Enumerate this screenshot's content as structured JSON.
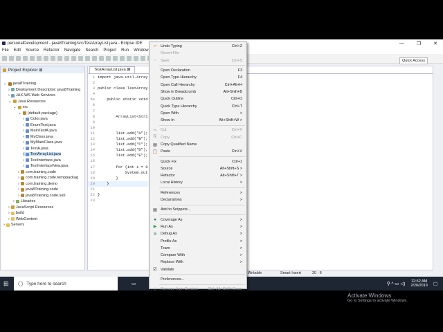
{
  "window": {
    "title": "personalDevelopment - java8Training/src/TestArrayList.java - Eclipse IDE",
    "controls": [
      "—",
      "❐",
      "✕"
    ]
  },
  "menubar": [
    "File",
    "Edit",
    "Source",
    "Refactor",
    "Navigate",
    "Search",
    "Project",
    "Run",
    "Window",
    "Help"
  ],
  "quick_access": "Quick Access",
  "project_explorer": {
    "title": "Project Explorer ⊠",
    "items": [
      {
        "label": "java8Training",
        "depth": 0,
        "arrow": "v",
        "color": "#a7742a"
      },
      {
        "label": "Deployment Descriptor: java8Training",
        "depth": 1,
        "arrow": ">",
        "color": "#7a9"
      },
      {
        "label": "JAX-WS Web Services",
        "depth": 1,
        "arrow": ">",
        "color": "#79b"
      },
      {
        "label": "Java Resources",
        "depth": 1,
        "arrow": "v",
        "color": "#c9a040"
      },
      {
        "label": "src",
        "depth": 2,
        "arrow": "v",
        "color": "#c9a040"
      },
      {
        "label": "(default package)",
        "depth": 3,
        "arrow": "v",
        "color": "#b8863b"
      },
      {
        "label": "Color.java",
        "depth": 4,
        "arrow": ">",
        "color": "#6a8fc7"
      },
      {
        "label": "EnumTest.java",
        "depth": 4,
        "arrow": ">",
        "color": "#6a8fc7"
      },
      {
        "label": "MainTestA.java",
        "depth": 4,
        "arrow": ">",
        "color": "#6a8fc7"
      },
      {
        "label": "MyClass.java",
        "depth": 4,
        "arrow": ">",
        "color": "#6a8fc7"
      },
      {
        "label": "MyMainClass.java",
        "depth": 4,
        "arrow": ">",
        "color": "#6a8fc7"
      },
      {
        "label": "TestA.java",
        "depth": 4,
        "arrow": ">",
        "color": "#6a8fc7"
      },
      {
        "label": "TestArrayList.java",
        "depth": 4,
        "arrow": ">",
        "color": "#6a8fc7",
        "selected": true
      },
      {
        "label": "TestInterface.java",
        "depth": 4,
        "arrow": ">",
        "color": "#6a8fc7"
      },
      {
        "label": "TestInterfaceNew.java",
        "depth": 4,
        "arrow": ">",
        "color": "#6a8fc7"
      },
      {
        "label": "com.training.code",
        "depth": 3,
        "arrow": ">",
        "color": "#b8863b"
      },
      {
        "label": "com.training.code.temppackag",
        "depth": 3,
        "arrow": ">",
        "color": "#b8863b"
      },
      {
        "label": "com.training.demo",
        "depth": 3,
        "arrow": ">",
        "color": "#b8863b"
      },
      {
        "label": "java8Training.code",
        "depth": 3,
        "arrow": ">",
        "color": "#b8863b"
      },
      {
        "label": "java8Training.code.sub",
        "depth": 3,
        "arrow": ">",
        "color": "#b8863b"
      },
      {
        "label": "Libraries",
        "depth": 2,
        "arrow": ">",
        "color": "#8a6"
      },
      {
        "label": "JavaScript Resources",
        "depth": 1,
        "arrow": ">",
        "color": "#c9a040"
      },
      {
        "label": "build",
        "depth": 1,
        "arrow": ">",
        "color": "#e0c060"
      },
      {
        "label": "WebContent",
        "depth": 1,
        "arrow": ">",
        "color": "#e0c060"
      },
      {
        "label": "Servers",
        "depth": 0,
        "arrow": ">",
        "color": "#e0c060"
      }
    ]
  },
  "editor": {
    "tab": "TestArrayList.java ⊠",
    "lines": [
      {
        "n": "1",
        "t": "import java.util.Array"
      },
      {
        "n": "2",
        "t": ""
      },
      {
        "n": "3",
        "t": "public class TestArray"
      },
      {
        "n": "4",
        "t": ""
      },
      {
        "n": "5⊖",
        "t": "    public static void"
      },
      {
        "n": "6",
        "t": ""
      },
      {
        "n": "7",
        "t": ""
      },
      {
        "n": "8",
        "t": "        ArrayList<Stri"
      },
      {
        "n": "9",
        "t": ""
      },
      {
        "n": "10",
        "t": ""
      },
      {
        "n": "11",
        "t": "        list.add(\"A\");"
      },
      {
        "n": "12",
        "t": "        list.add(\"B\");"
      },
      {
        "n": "13",
        "t": "        list.add(\"C\");"
      },
      {
        "n": "14",
        "t": "        list.add(\"D\");"
      },
      {
        "n": "15",
        "t": "        list.add(\"E\");"
      },
      {
        "n": "16",
        "t": ""
      },
      {
        "n": "17",
        "t": "        for (int i = 0"
      },
      {
        "n": "18",
        "t": "            System.out"
      },
      {
        "n": "19",
        "t": "        }"
      },
      {
        "n": "20",
        "t": "    }"
      },
      {
        "n": "21",
        "t": ""
      },
      {
        "n": "22",
        "t": "}"
      },
      {
        "n": "23",
        "t": ""
      }
    ]
  },
  "status": {
    "writable": "Writable",
    "insert": "Smart Insert",
    "position": "20 : 6"
  },
  "context_menu": [
    {
      "label": "Undo Typing",
      "shortcut": "Ctrl+Z",
      "icon": "↶"
    },
    {
      "label": "Revert File",
      "disabled": true
    },
    {
      "label": "Save",
      "shortcut": "Ctrl+S",
      "disabled": true,
      "icon": "▫"
    },
    {
      "sep": true
    },
    {
      "label": "Open Declaration",
      "shortcut": "F3"
    },
    {
      "label": "Open Type Hierarchy",
      "shortcut": "F4"
    },
    {
      "label": "Open Call Hierarchy",
      "shortcut": "Ctrl+Alt+H"
    },
    {
      "label": "Show in Breadcrumb",
      "shortcut": "Alt+Shift+B"
    },
    {
      "label": "Quick Outline",
      "shortcut": "Ctrl+O"
    },
    {
      "label": "Quick Type Hierarchy",
      "shortcut": "Ctrl+T"
    },
    {
      "label": "Open With",
      "shortcut": ">"
    },
    {
      "label": "Show In",
      "shortcut": "Alt+Shift+W >"
    },
    {
      "sep": true
    },
    {
      "label": "Cut",
      "shortcut": "Ctrl+X",
      "disabled": true,
      "icon": "✂"
    },
    {
      "label": "Copy",
      "shortcut": "Ctrl+C",
      "disabled": true,
      "icon": "⎘"
    },
    {
      "label": "Copy Qualified Name",
      "icon": "▤"
    },
    {
      "label": "Paste",
      "shortcut": "Ctrl+V",
      "icon": "📋"
    },
    {
      "sep": true
    },
    {
      "label": "Quick Fix",
      "shortcut": "Ctrl+1"
    },
    {
      "label": "Source",
      "shortcut": "Alt+Shift+S >"
    },
    {
      "label": "Refactor",
      "shortcut": "Alt+Shift+T >"
    },
    {
      "label": "Local History",
      "shortcut": ">"
    },
    {
      "sep": true
    },
    {
      "label": "References",
      "shortcut": ">"
    },
    {
      "label": "Declarations",
      "shortcut": ">"
    },
    {
      "sep": true
    },
    {
      "label": "Add to Snippets...",
      "icon": "▤"
    },
    {
      "sep": true
    },
    {
      "label": "Coverage As",
      "shortcut": ">",
      "icon": "●"
    },
    {
      "label": "Run As",
      "shortcut": ">",
      "icon": "▶"
    },
    {
      "label": "Debug As",
      "shortcut": ">",
      "icon": "✲"
    },
    {
      "label": "Profile As",
      "shortcut": ">"
    },
    {
      "label": "Team",
      "shortcut": ">"
    },
    {
      "label": "Compare With",
      "shortcut": ">"
    },
    {
      "label": "Replace With",
      "shortcut": ">"
    },
    {
      "label": "Validate",
      "icon": "☑"
    },
    {
      "sep": true
    },
    {
      "label": "Preferences..."
    },
    {
      "sep": true
    },
    {
      "label": "Remove from Context",
      "shortcut": "Ctrl+Alt+Shift+Down",
      "disabled": true,
      "icon": "⋮"
    }
  ],
  "watermark": {
    "title": "Activate Windows",
    "sub": "Go to Settings to activate Windows."
  },
  "taskbar": {
    "search_placeholder": "Type here to search",
    "time": "12:52 AM",
    "date": "2/20/2019"
  }
}
